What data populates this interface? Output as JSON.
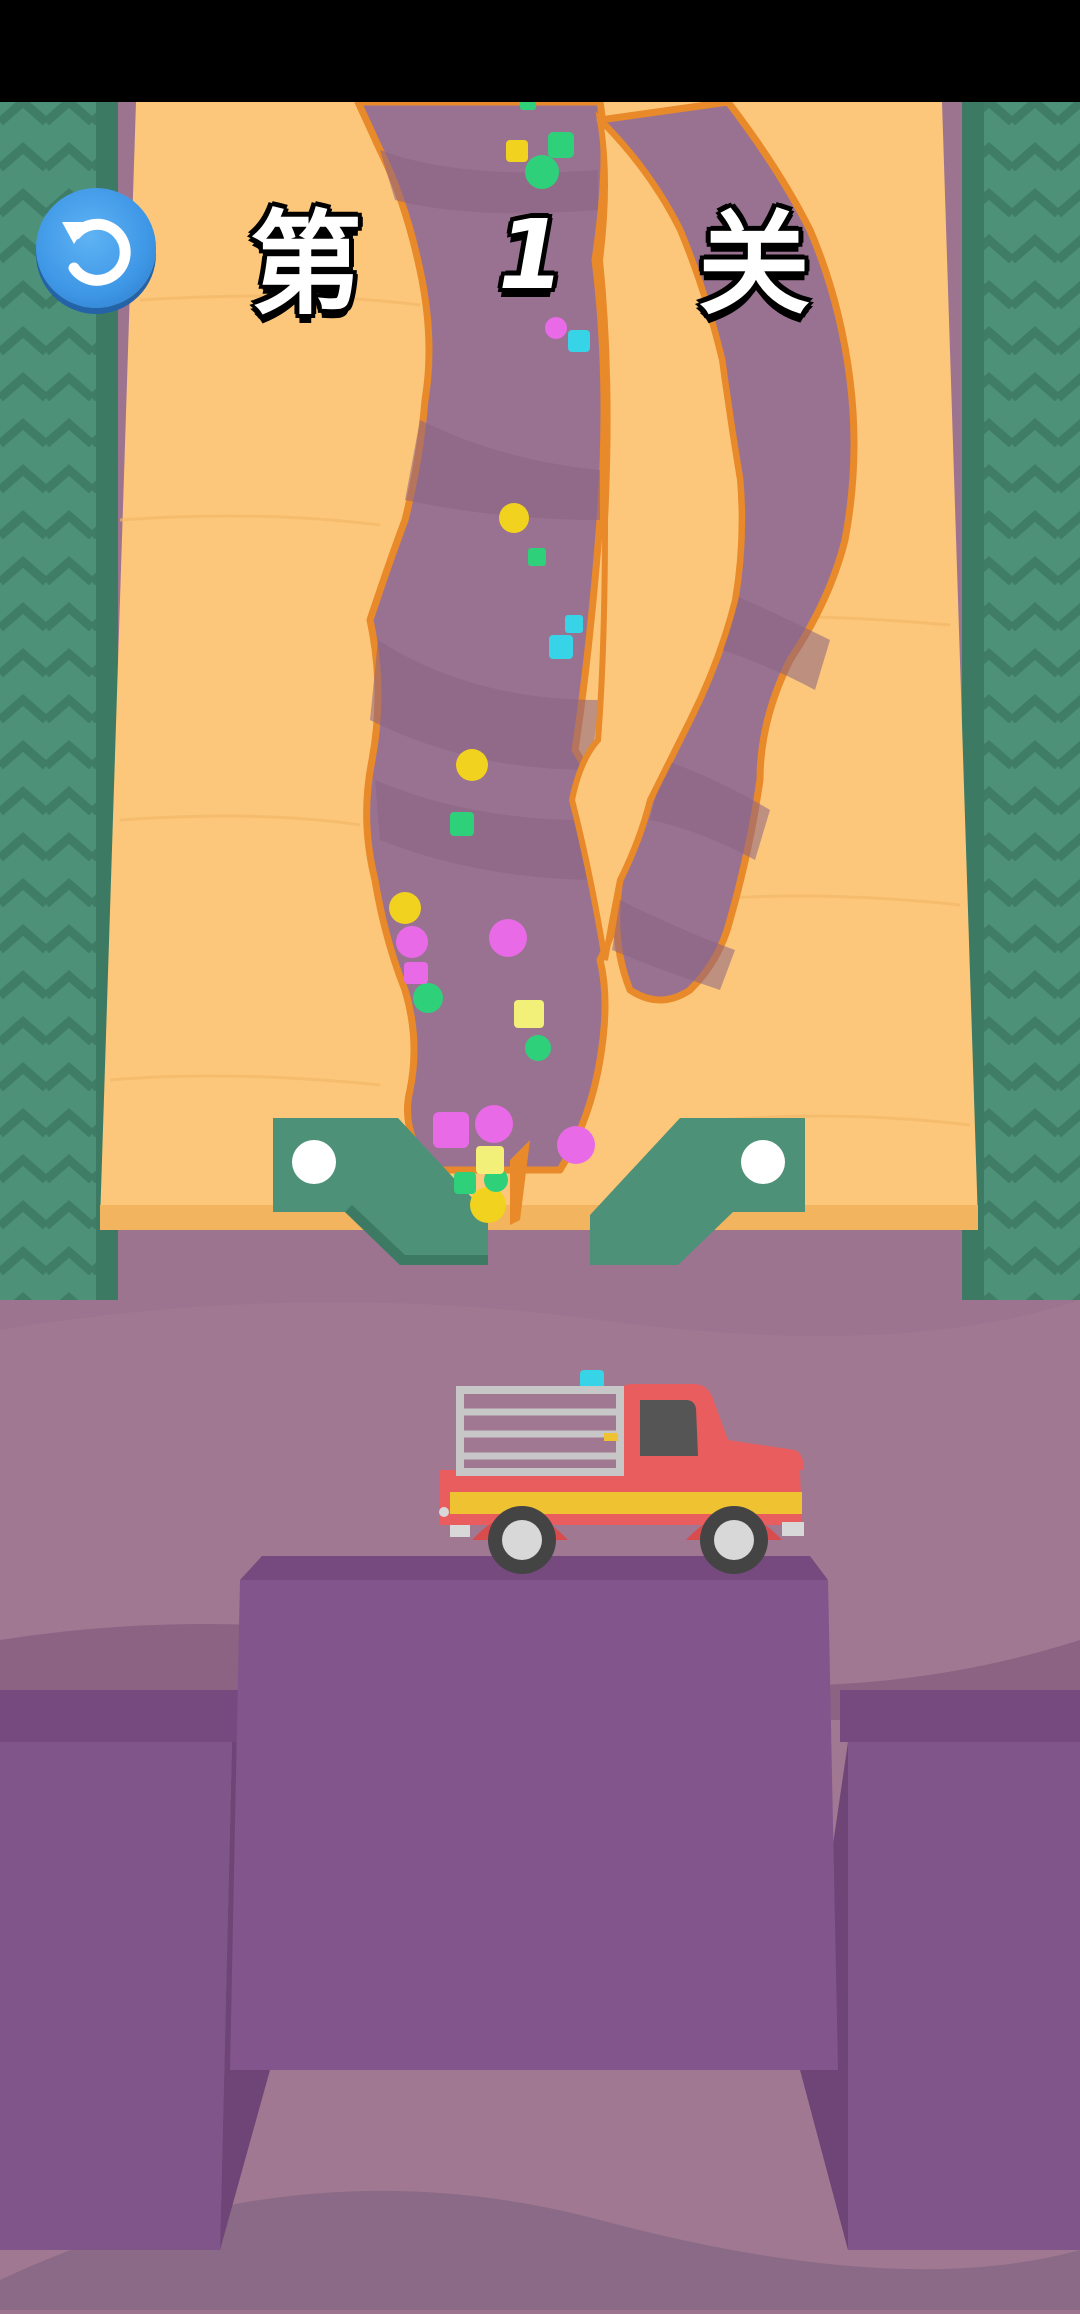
{
  "header": {
    "level_prefix": "第",
    "level_number": "1",
    "level_suffix": "关"
  },
  "buttons": {
    "restart_icon": "restart-icon"
  },
  "colors": {
    "sand": "#fcc77a",
    "dug_tunnel": "#9a7291",
    "wall_green": "#4d9178",
    "platform_purple": "#80558a",
    "truck_red": "#ea5d5e",
    "truck_stripe": "#eec230",
    "restart_blue": "#3e97e6"
  },
  "gems": {
    "colors": [
      "#f0d21f",
      "#2fd07a",
      "#e86ae6",
      "#37d3e6",
      "#f3f07a"
    ]
  }
}
